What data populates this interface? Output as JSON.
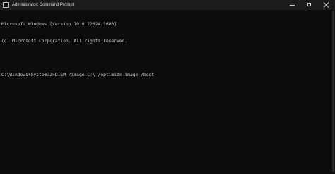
{
  "window": {
    "title": "Administrator: Command Prompt"
  },
  "console": {
    "lines": [
      "Microsoft Windows [Version 10.0.22624.1680]",
      "(c) Microsoft Corporation. All rights reserved."
    ],
    "prompt": "C:\\Windows\\System32>",
    "command": "DISM /image:C:\\ /optimize-image /boot"
  },
  "icons": {
    "app": "terminal-icon",
    "minimize": "minimize-icon",
    "maximize": "maximize-icon",
    "close": "close-icon"
  },
  "colors": {
    "background": "#0c0c0c",
    "titlebar": "#1c1c1c",
    "text": "#cccccc"
  }
}
